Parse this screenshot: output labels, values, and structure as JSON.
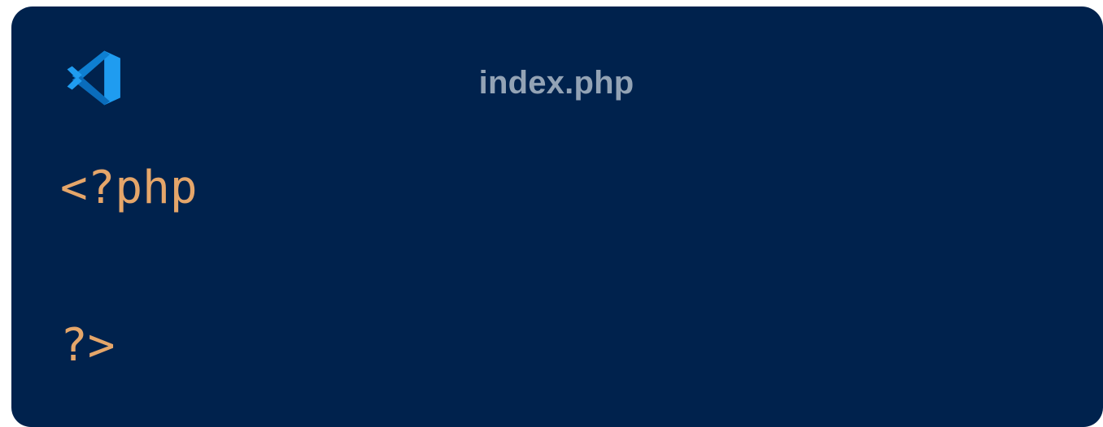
{
  "window": {
    "title": "index.php",
    "logo_icon": "vscode-icon",
    "background_color": "#00224d"
  },
  "editor": {
    "lines": [
      "<?php",
      "",
      "?>"
    ],
    "text_color": "#e5a66a"
  }
}
